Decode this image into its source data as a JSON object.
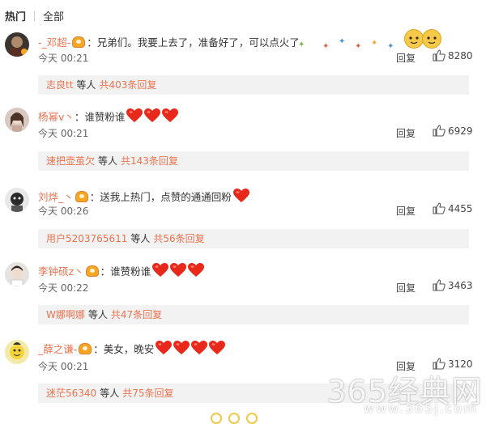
{
  "tabs": [
    "热门",
    "全部"
  ],
  "comments": [
    {
      "username": "-_邓超-",
      "text": "兄弟们。我要上去了，准备好了，可以点火了",
      "heart_count": 0,
      "time": "今天 00:21",
      "reply_label": "回复",
      "likes": "8280",
      "reply_user": "志良tt",
      "reply_mid": "等人",
      "reply_count": "共403条回复"
    },
    {
      "username": "杨幂v丶",
      "text": "谁赞粉谁",
      "heart_count": 3,
      "time": "今天 00:21",
      "reply_label": "回复",
      "likes": "6929",
      "reply_user": "速把壶茧欠",
      "reply_mid": "等人",
      "reply_count": "共143条回复"
    },
    {
      "username": "刘烨_丶",
      "text": "送我上热门，点赞的通通回粉",
      "heart_count": 1,
      "time": "今天 00:26",
      "reply_label": "回复",
      "likes": "4455",
      "reply_user": "用户5203765611",
      "reply_mid": "等人",
      "reply_count": "共56条回复"
    },
    {
      "username": "李钟硕z丶",
      "text": "谁赞粉谁",
      "heart_count": 3,
      "time": "今天 00:22",
      "reply_label": "回复",
      "likes": "3463",
      "reply_user": "W娜啊娜",
      "reply_mid": "等人",
      "reply_count": "共47条回复"
    },
    {
      "username": "_薛之谦-",
      "text": "美女，晚安",
      "heart_count": 4,
      "time": "今天 00:21",
      "reply_label": "回复",
      "likes": "3120",
      "reply_user": "迷茫56340",
      "reply_mid": "等人",
      "reply_count": "共75条回复"
    }
  ],
  "watermark": {
    "main": "365经典网",
    "url": "www.365j.com"
  },
  "colors": {
    "username": "#eb7350",
    "heart": "#e8281a",
    "reply_bg": "#f2f2f2"
  },
  "icons": [
    "vip-badge-icon",
    "heart-icon",
    "thumbs-up-icon",
    "cat-emoji-icon"
  ]
}
